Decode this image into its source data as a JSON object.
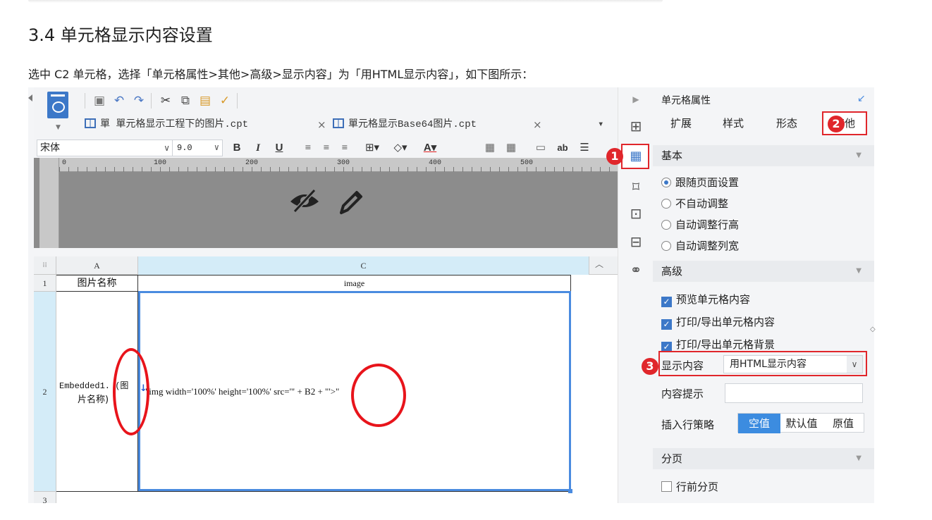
{
  "doc": {
    "heading": "3.4 单元格显示内容设置",
    "description": "选中 C2 单元格，选择「单元格属性>其他>高级>显示内容」为「用HTML显示内容」，如下图所示："
  },
  "designer": {
    "tabs": [
      {
        "label": "單 單元格显示工程下的图片.cpt",
        "close": "×"
      },
      {
        "label": "單元格显示Base64图片.cpt",
        "close": "×"
      }
    ],
    "font": {
      "name": "宋体",
      "size": "9.0"
    },
    "format_buttons": [
      "B",
      "I",
      "U"
    ],
    "ruler_marks": [
      "0",
      "100",
      "200",
      "300",
      "400",
      "500"
    ],
    "grid": {
      "col_a": "A",
      "col_c": "C",
      "rows": [
        "1",
        "2",
        "3"
      ],
      "a1": "图片名称",
      "c1": "image",
      "a2_line1": "Embedded1. (图",
      "a2_line2": "片名称)",
      "c2": "\"img width='100%' height='100%' src='\" + B2 + \"'>\""
    }
  },
  "panel": {
    "title": "单元格属性",
    "tabs": [
      "扩展",
      "样式",
      "形态",
      "其他"
    ],
    "sections": {
      "basic": "基本",
      "advanced": "高级",
      "paging": "分页"
    },
    "basic_options": [
      "跟随页面设置",
      "不自动调整",
      "自动调整行高",
      "自动调整列宽"
    ],
    "advanced_options": [
      "预览单元格内容",
      "打印/导出单元格内容",
      "打印/导出单元格背景"
    ],
    "display_label": "显示内容",
    "display_value": "用HTML显示内容",
    "tip_label": "内容提示",
    "insert_label": "插入行策略",
    "insert_options": [
      "空值",
      "默认值",
      "原值"
    ],
    "paging_option": "行前分页"
  },
  "callouts": [
    "1",
    "2",
    "3"
  ],
  "colors": {
    "accent": "#3c78c8",
    "selection": "#4a8be0",
    "annotation": "#e0262b"
  }
}
